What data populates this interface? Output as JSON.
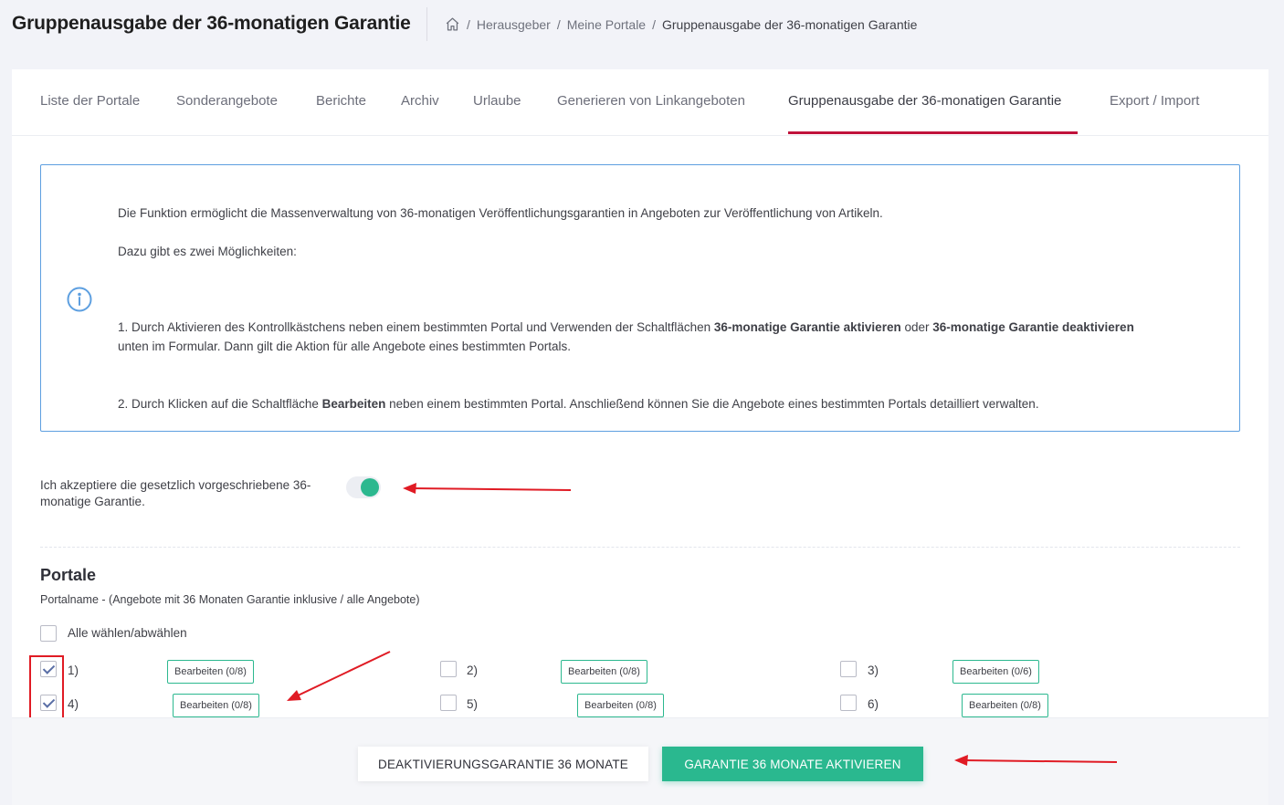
{
  "header": {
    "page_title": "Gruppenausgabe der 36-monatigen Garantie",
    "breadcrumb": [
      "Herausgeber",
      "Meine Portale",
      "Gruppenausgabe der 36-monatigen Garantie"
    ],
    "breadcrumb_separator": "/"
  },
  "tabs": [
    {
      "label": "Liste der Portale"
    },
    {
      "label": "Sonderangebote"
    },
    {
      "label": "Berichte"
    },
    {
      "label": "Archiv"
    },
    {
      "label": "Urlaube"
    },
    {
      "label": "Generieren von Linkangeboten"
    },
    {
      "label": "Gruppenausgabe der 36-monatigen Garantie",
      "active": true
    },
    {
      "label": "Export / Import"
    }
  ],
  "info": {
    "line1": "Die Funktion ermöglicht die Massenverwaltung von 36-monatigen Veröffentlichungsgarantien in Angeboten zur Veröffentlichung von Artikeln.",
    "line2": "Dazu gibt es zwei Möglichkeiten:",
    "option1_pre": "1. Durch Aktivieren des Kontrollkästchens neben einem bestimmten Portal und Verwenden der Schaltflächen ",
    "option1_bold1": "36-monatige Garantie aktivieren",
    "option1_mid": " oder ",
    "option1_bold2": "36-monatige Garantie deaktivieren",
    "option1_post": "unten im Formular. Dann gilt die Aktion für alle Angebote eines bestimmten Portals.",
    "option2_pre": "2. Durch Klicken auf die Schaltfläche ",
    "option2_bold": "Bearbeiten",
    "option2_post": " neben einem bestimmten Portal. Anschließend können Sie die Angebote eines bestimmten Portals detailliert verwalten."
  },
  "consent": {
    "label": "Ich akzeptiere die gesetzlich vorgeschriebene 36-monatige Garantie.",
    "enabled": true
  },
  "portals": {
    "title": "Portale",
    "subtitle": "Portalname - (Angebote mit 36 Monaten Garantie inklusive / alle Angebote)",
    "select_all_label": "Alle wählen/abwählen",
    "items": [
      {
        "label": "1)",
        "checked": true,
        "edit_label": "Bearbeiten (0/8)"
      },
      {
        "label": "2)",
        "checked": false,
        "edit_label": "Bearbeiten (0/8)"
      },
      {
        "label": "3)",
        "checked": false,
        "edit_label": "Bearbeiten (0/6)"
      },
      {
        "label": "4)",
        "checked": true,
        "edit_label": "Bearbeiten (0/8)"
      },
      {
        "label": "5)",
        "checked": false,
        "edit_label": "Bearbeiten (0/8)"
      },
      {
        "label": "6)",
        "checked": false,
        "edit_label": "Bearbeiten (0/8)"
      }
    ]
  },
  "footer": {
    "deactivate_label": "Deaktivierungsgarantie 36 Monate",
    "activate_label": "GARANTIE 36 MONATE AKTIVIEREN"
  },
  "colors": {
    "accent_green": "#2ab88f",
    "tab_active_underline": "#c0123b",
    "info_border": "#5d9fe0",
    "annotation_red": "#e01b24"
  }
}
